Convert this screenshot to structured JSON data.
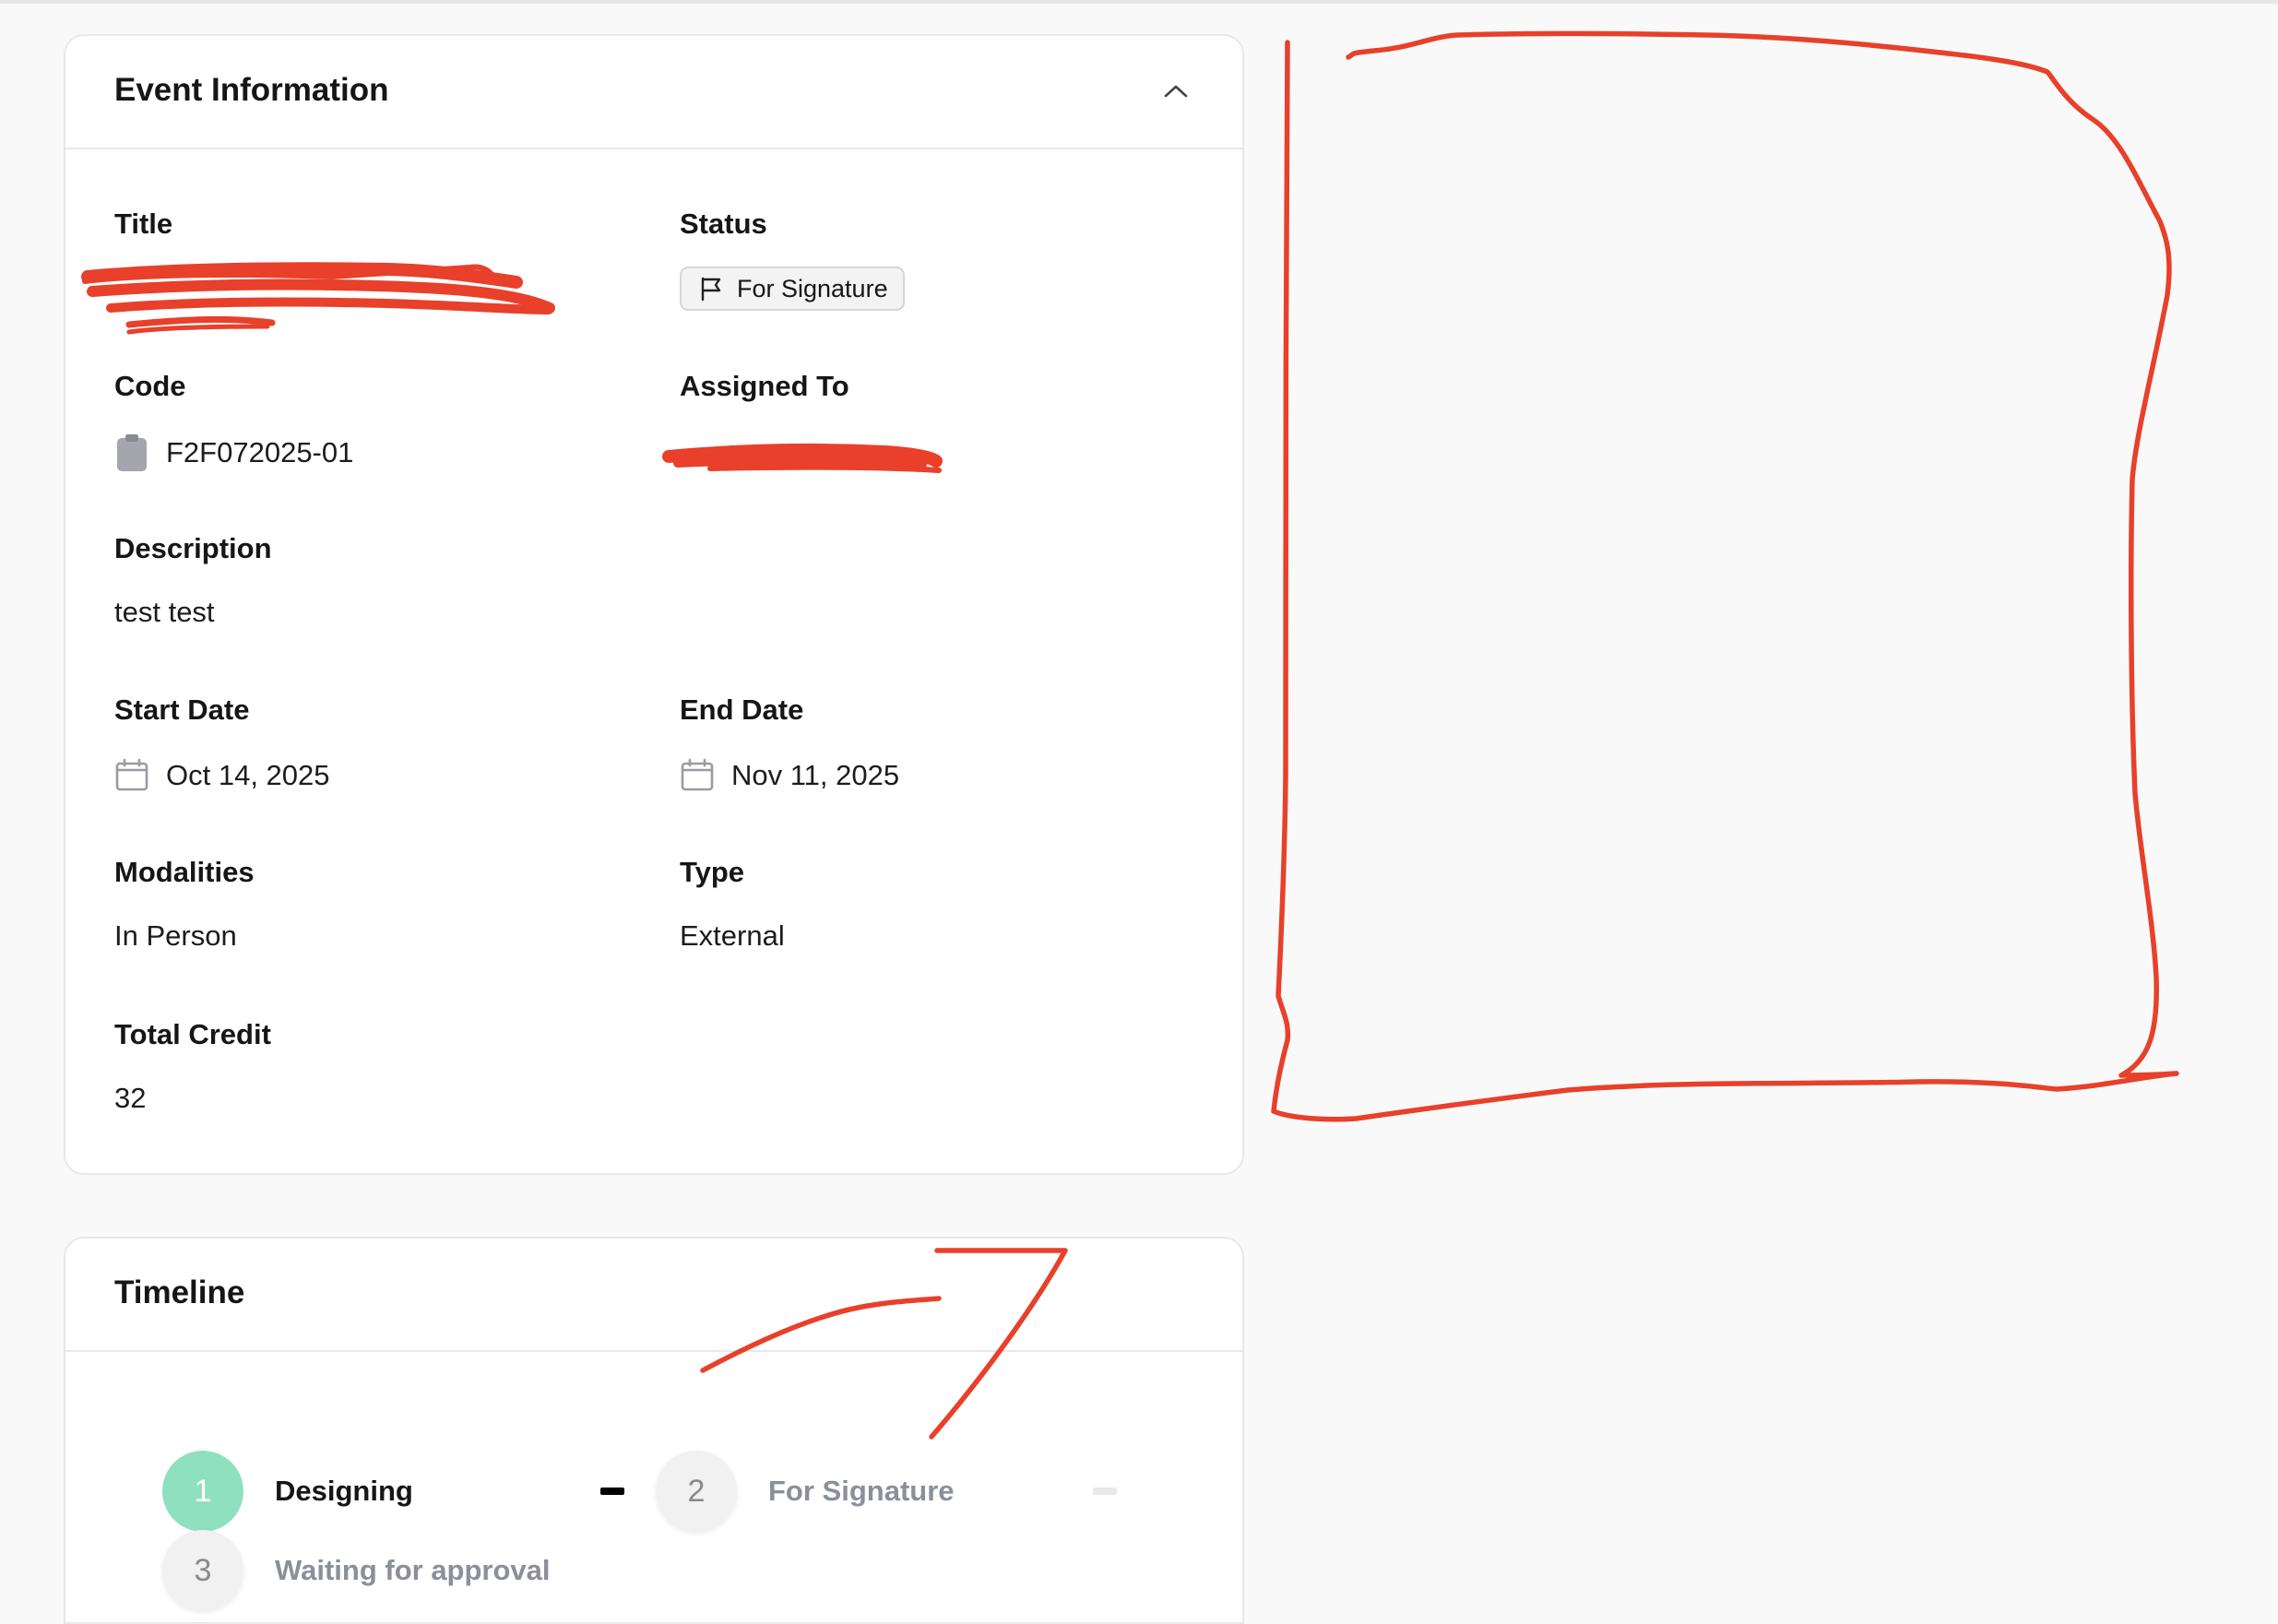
{
  "event_info": {
    "title": "Event Information",
    "fields": {
      "title": {
        "label": "Title",
        "value": ""
      },
      "status": {
        "label": "Status",
        "value": "For Signature",
        "icon": "flag-icon"
      },
      "code": {
        "label": "Code",
        "value": "F2F072025-01",
        "icon": "clipboard-icon"
      },
      "assigned_to": {
        "label": "Assigned To",
        "value": ""
      },
      "description": {
        "label": "Description",
        "value": "test test"
      },
      "start_date": {
        "label": "Start Date",
        "value": "Oct 14, 2025",
        "icon": "calendar-icon"
      },
      "end_date": {
        "label": "End Date",
        "value": "Nov 11, 2025",
        "icon": "calendar-icon"
      },
      "modalities": {
        "label": "Modalities",
        "value": "In Person"
      },
      "type": {
        "label": "Type",
        "value": "External"
      },
      "total_credit": {
        "label": "Total Credit",
        "value": "32"
      }
    }
  },
  "timeline": {
    "title": "Timeline",
    "steps": [
      {
        "number": "1",
        "label": "Designing",
        "state": "done"
      },
      {
        "number": "2",
        "label": "For Signature",
        "state": "pending"
      },
      {
        "number": "3",
        "label": "Waiting for approval",
        "state": "pending"
      }
    ]
  },
  "colors": {
    "page_bg": "#f9f9f9",
    "card_bg": "#ffffff",
    "step_done": "#8fe0bf",
    "annotation_red": "#e8402a"
  }
}
